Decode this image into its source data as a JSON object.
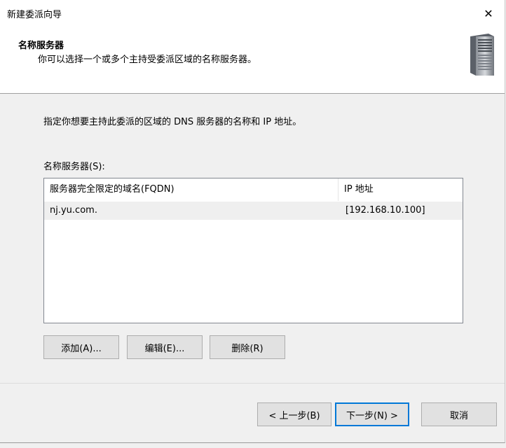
{
  "window": {
    "title": "新建委派向导",
    "close_glyph": "✕"
  },
  "header": {
    "title": "名称服务器",
    "subtitle": "你可以选择一个或多个主持受委派区域的名称服务器。",
    "icon": "server-tower-icon"
  },
  "body": {
    "intro": "指定你想要主持此委派的区域的 DNS 服务器的名称和 IP 地址。",
    "list_label": "名称服务器(S):",
    "columns": [
      "服务器完全限定的域名(FQDN)",
      "IP 地址"
    ],
    "rows": [
      {
        "fqdn": "nj.yu.com.",
        "ip": "[192.168.10.100]"
      }
    ],
    "buttons": {
      "add": "添加(A)...",
      "edit": "编辑(E)...",
      "delete": "删除(R)"
    }
  },
  "footer": {
    "back": "< 上一步(B)",
    "next": "下一步(N) >",
    "cancel": "取消"
  },
  "colors": {
    "accent": "#0078d7",
    "selected_row": "#efefef"
  }
}
